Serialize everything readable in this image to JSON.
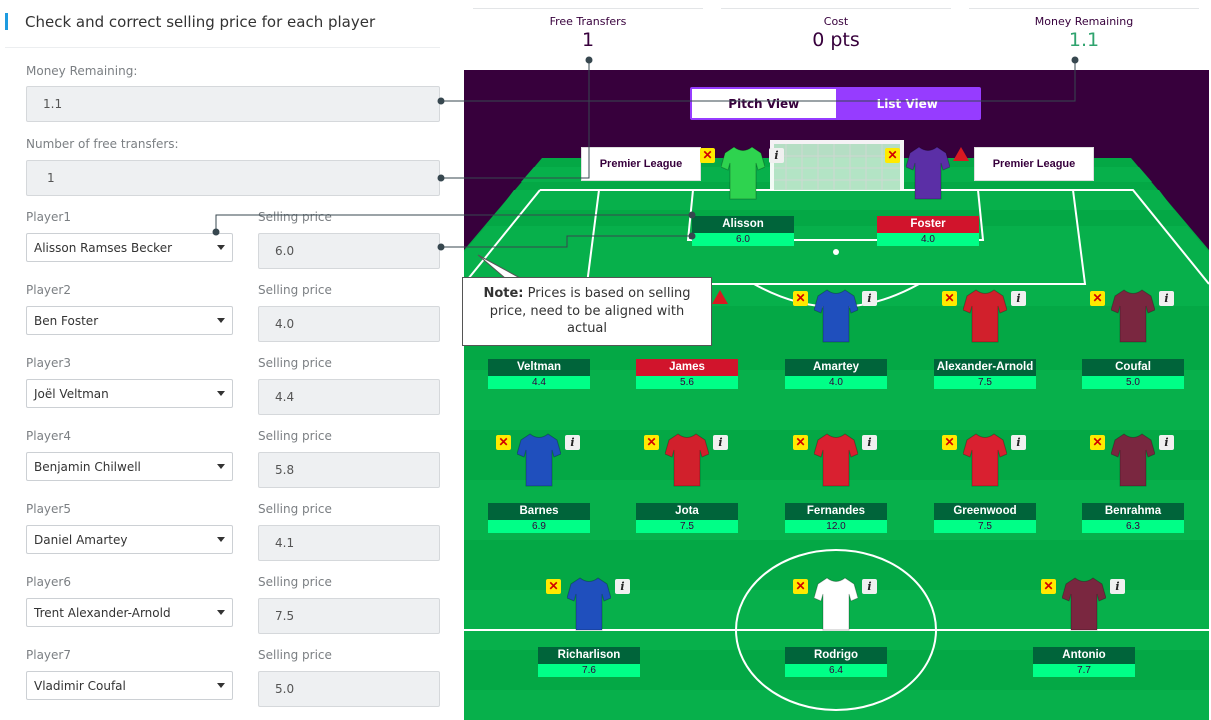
{
  "form": {
    "title": "Check and correct selling price for each player",
    "money_label": "Money Remaining:",
    "money_value": "1.1",
    "free_transfers_label": "Number of free transfers:",
    "free_transfers_value": "1",
    "selling_price_label": "Selling price",
    "players": [
      {
        "label": "Player1",
        "selected": "Alisson Ramses Becker",
        "price": "6.0"
      },
      {
        "label": "Player2",
        "selected": "Ben Foster",
        "price": "4.0"
      },
      {
        "label": "Player3",
        "selected": "Joël Veltman",
        "price": "4.4"
      },
      {
        "label": "Player4",
        "selected": "Benjamin Chilwell",
        "price": "5.8"
      },
      {
        "label": "Player5",
        "selected": "Daniel Amartey",
        "price": "4.1"
      },
      {
        "label": "Player6",
        "selected": "Trent Alexander-Arnold",
        "price": "7.5"
      },
      {
        "label": "Player7",
        "selected": "Vladimir Coufal",
        "price": "5.0"
      }
    ]
  },
  "stats": {
    "free_transfers": {
      "label": "Free Transfers",
      "value": "1"
    },
    "cost": {
      "label": "Cost",
      "value": "0 pts"
    },
    "money_remaining": {
      "label": "Money Remaining",
      "value": "1.1"
    }
  },
  "pitch": {
    "tabs": {
      "pitch_view": "Pitch View",
      "list_view": "List View"
    },
    "sponsor_board": "Premier League",
    "gk": [
      {
        "name": "Alisson",
        "price": "6.0",
        "kit": "#2ed34f",
        "kit_icon": "green-goalkeeper-shirt-icon",
        "status": "normal"
      },
      {
        "name": "Foster",
        "price": "4.0",
        "kit": "#5b2fa6",
        "kit_icon": "purple-goalkeeper-shirt-icon",
        "status": "flagged"
      }
    ],
    "def": [
      {
        "name": "Veltman",
        "price": "4.4",
        "kit": "#2255c7",
        "status": "normal"
      },
      {
        "name": "James",
        "price": "5.6",
        "kit": "#1a3fa8",
        "status": "flagged"
      },
      {
        "name": "Amartey",
        "price": "4.0",
        "kit": "#1f4fbd",
        "status": "normal"
      },
      {
        "name": "Alexander-Arnold",
        "price": "7.5",
        "kit": "#d1202c",
        "status": "normal"
      },
      {
        "name": "Coufal",
        "price": "5.0",
        "kit": "#7a2740",
        "status": "normal"
      }
    ],
    "mid": [
      {
        "name": "Barnes",
        "price": "6.9",
        "kit": "#1f4fbd",
        "status": "normal"
      },
      {
        "name": "Jota",
        "price": "7.5",
        "kit": "#d1202c",
        "status": "normal"
      },
      {
        "name": "Fernandes",
        "price": "12.0",
        "kit": "#d92030",
        "status": "normal"
      },
      {
        "name": "Greenwood",
        "price": "7.5",
        "kit": "#d92030",
        "status": "normal"
      },
      {
        "name": "Benrahma",
        "price": "6.3",
        "kit": "#7a2740",
        "status": "normal"
      }
    ],
    "fwd": [
      {
        "name": "Richarlison",
        "price": "7.6",
        "kit": "#1f4fbd",
        "status": "normal"
      },
      {
        "name": "Rodrigo",
        "price": "6.4",
        "kit": "#ffffff",
        "status": "normal"
      },
      {
        "name": "Antonio",
        "price": "7.7",
        "kit": "#7a2740",
        "status": "normal"
      }
    ]
  },
  "note": {
    "bold": "Note:",
    "text": " Prices is based on selling price, need to be aligned with actual"
  },
  "colors": {
    "accent": "#1e9be0",
    "pitch_purple": "#37003c",
    "grass": "#04a845",
    "name_bar": "#00643a",
    "flag_red": "#d1142c",
    "price_bar": "#00ff87",
    "toggle_active": "#963cff"
  }
}
